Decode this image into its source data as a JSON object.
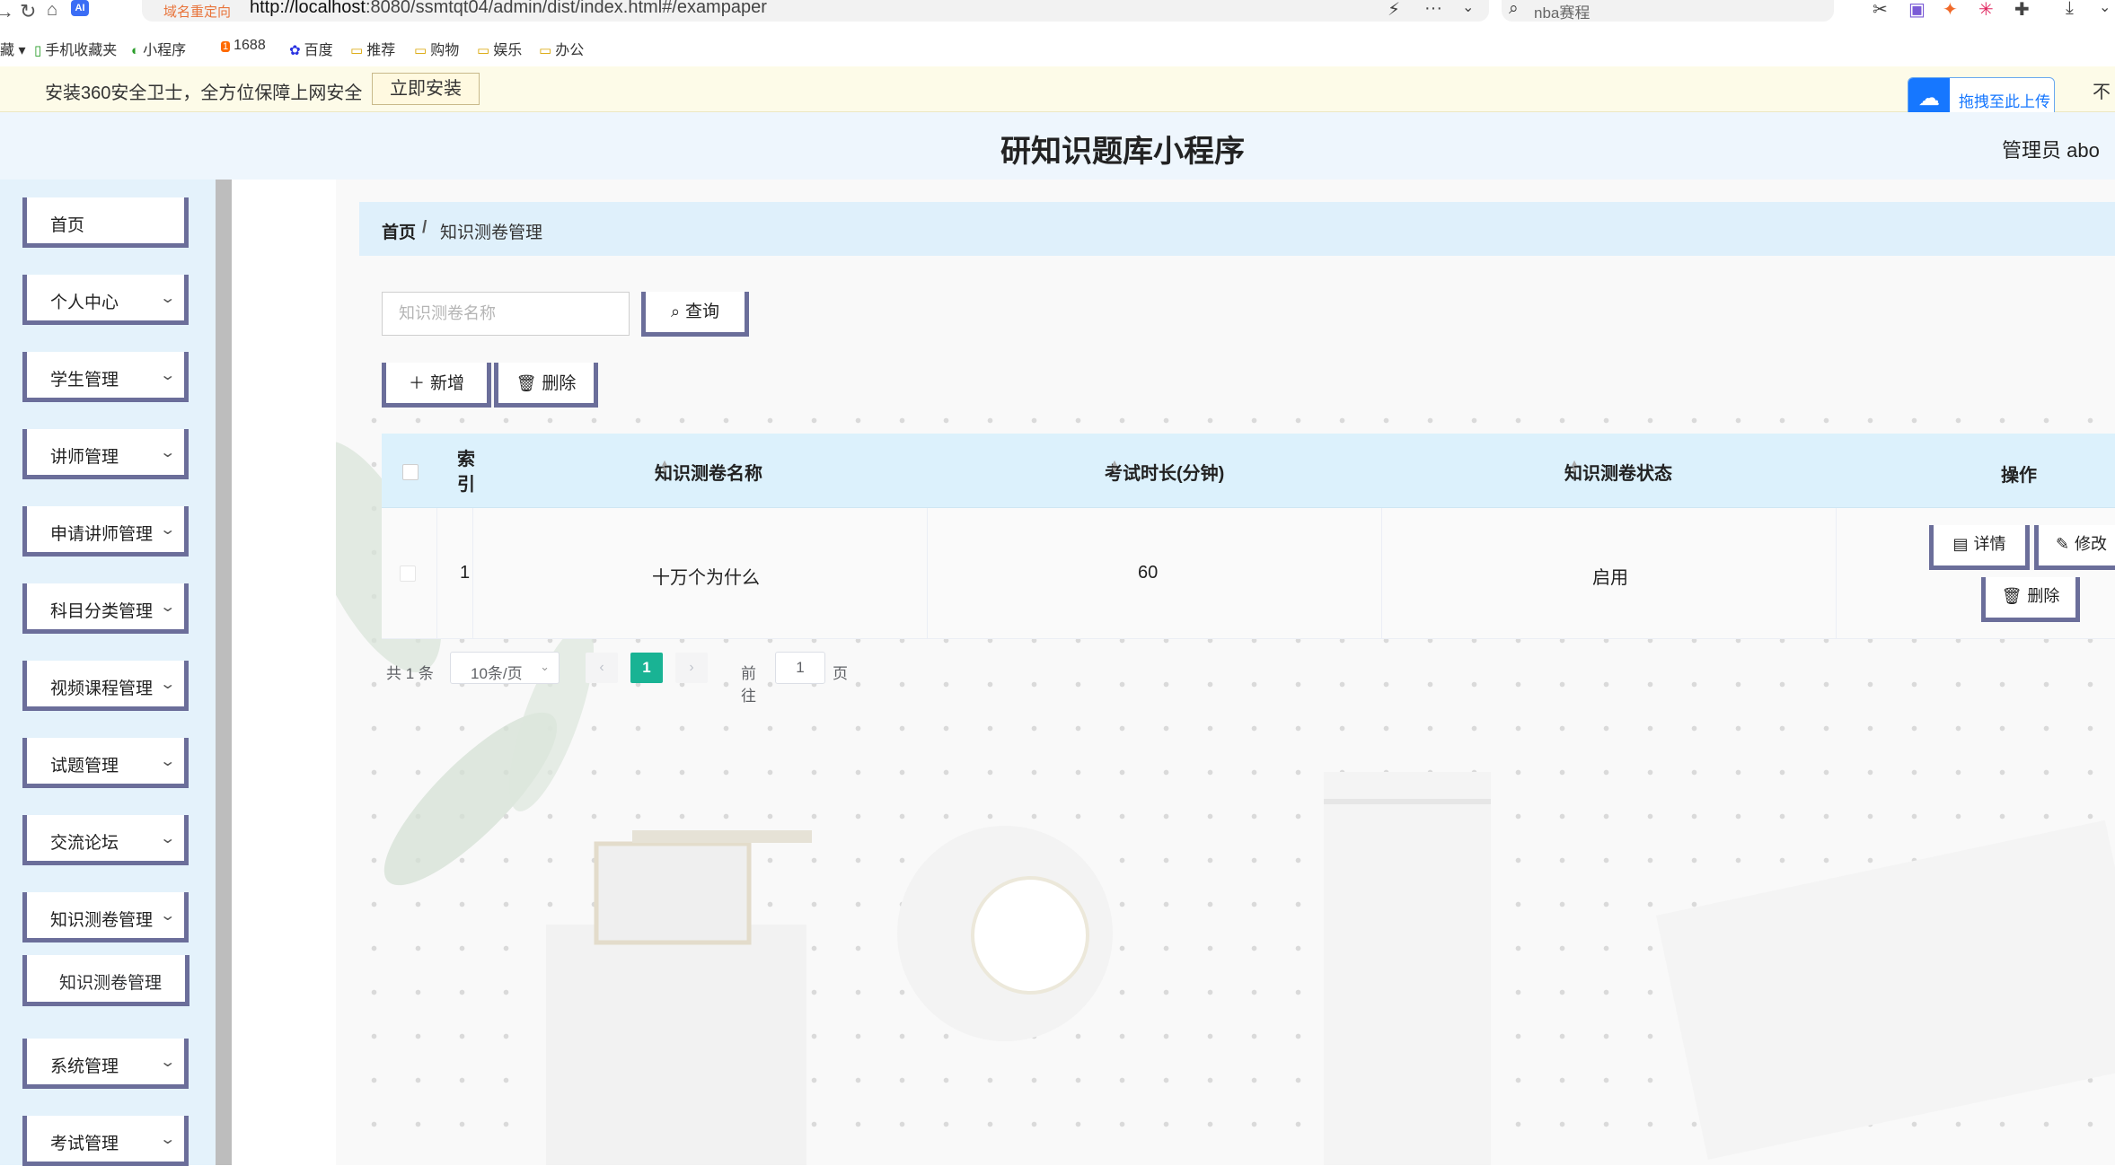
{
  "browser": {
    "redirect_label": "域名重定向",
    "url_host": "http://localhost",
    "url_rest": ":8080/ssmtqt04/admin/dist/index.html#/exampaper",
    "search_text": "nba赛程",
    "bookmarks": [
      {
        "label": "手机收藏夹",
        "icon": "phone-icon"
      },
      {
        "label": "小程序",
        "icon": "miniprogram-icon"
      },
      {
        "label": "1688",
        "icon": "alibaba-icon"
      },
      {
        "label": "百度",
        "icon": "baidu-icon"
      },
      {
        "label": "推荐",
        "icon": "folder-icon"
      },
      {
        "label": "购物",
        "icon": "folder-icon"
      },
      {
        "label": "娱乐",
        "icon": "folder-icon"
      },
      {
        "label": "办公",
        "icon": "folder-icon"
      }
    ]
  },
  "infobar": {
    "message": "安装360安全卫士，全方位保障上网安全",
    "install_label": "立即安装",
    "upload_label": "拖拽至此上传",
    "close_label": "不"
  },
  "header": {
    "title": "研知识题库小程序",
    "admin_label": "管理员 abo"
  },
  "sidebar": {
    "items": [
      {
        "label": "首页",
        "has_arrow": false
      },
      {
        "label": "个人中心",
        "has_arrow": true
      },
      {
        "label": "学生管理",
        "has_arrow": true
      },
      {
        "label": "讲师管理",
        "has_arrow": true
      },
      {
        "label": "申请讲师管理",
        "has_arrow": true
      },
      {
        "label": "科目分类管理",
        "has_arrow": true
      },
      {
        "label": "视频课程管理",
        "has_arrow": true
      },
      {
        "label": "试题管理",
        "has_arrow": true
      },
      {
        "label": "交流论坛",
        "has_arrow": true
      },
      {
        "label": "知识测卷管理",
        "has_arrow": true
      },
      {
        "label": "系统管理",
        "has_arrow": true
      },
      {
        "label": "考试管理",
        "has_arrow": true
      }
    ],
    "sub_item": "知识测卷管理"
  },
  "breadcrumb": {
    "home": "首页",
    "separator": "/",
    "current": "知识测卷管理"
  },
  "search": {
    "placeholder": "知识测卷名称",
    "value": "",
    "button_label": "查询"
  },
  "toolbar": {
    "add_label": "新增",
    "delete_label": "删除"
  },
  "table": {
    "columns": {
      "index": "索引",
      "name": "知识测卷名称",
      "duration": "考试时长(分钟)",
      "status": "知识测卷状态",
      "actions": "操作"
    },
    "rows": [
      {
        "index": "1",
        "name": "十万个为什么",
        "duration": "60",
        "status": "启用"
      }
    ],
    "row_actions": {
      "detail": "详情",
      "edit": "修改",
      "delete": "删除"
    }
  },
  "pagination": {
    "total_text": "共 1 条",
    "page_size": "10条/页",
    "current_page": "1",
    "goto_label": "前往",
    "goto_value": "1",
    "page_unit": "页"
  },
  "colors": {
    "accent_border": "#6b6e9a",
    "header_bg": "#eef6fd",
    "table_head_bg": "#dcf1fc",
    "active_page": "#19b394"
  }
}
